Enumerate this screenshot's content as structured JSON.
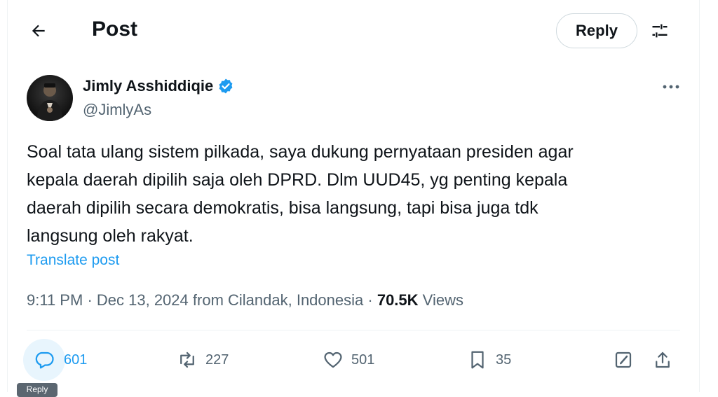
{
  "header": {
    "title": "Post",
    "reply_label": "Reply",
    "back_icon": "back-arrow-icon",
    "filter_icon": "sliders-icon"
  },
  "author": {
    "name": "Jimly Asshiddiqie",
    "handle": "@JimlyAs",
    "verified": true,
    "verified_color": "#1d9bf0"
  },
  "post": {
    "text": "Soal tata ulang sistem pilkada, saya dukung pernyataan presiden agar\nkepala daerah dipilih saja oleh DPRD. Dlm UUD45, yg penting kepala\ndaerah dipilih secara demokratis, bisa langsung, tapi bisa juga tdk\nlangsung oleh rakyat.",
    "translate_label": "Translate post",
    "time": "9:11 PM",
    "date": "Dec 13, 2024",
    "location": "from Cilandak, Indonesia",
    "views_count": "70.5K",
    "views_label": "Views"
  },
  "actions": {
    "replies": "601",
    "reposts": "227",
    "likes": "501",
    "bookmarks": "35"
  },
  "tooltip": {
    "label": "Reply"
  },
  "colors": {
    "accent": "#1d9bf0",
    "muted": "#536471",
    "text": "#0f1419"
  }
}
